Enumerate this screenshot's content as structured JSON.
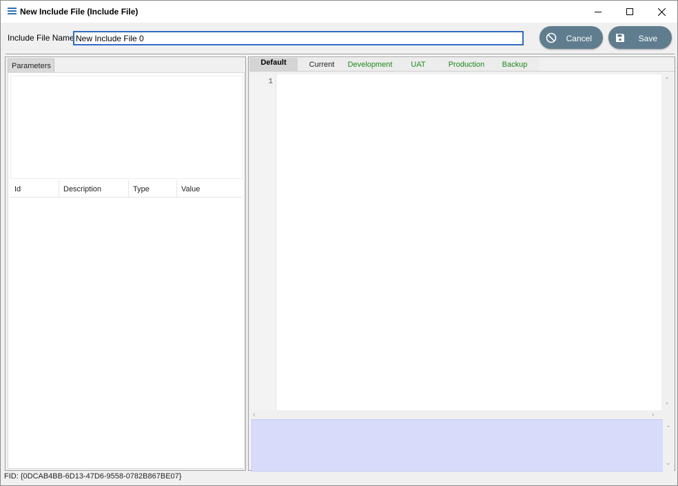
{
  "window": {
    "title": "New Include File (Include File)",
    "icon": "menu-lines-icon"
  },
  "form": {
    "name_label": "Include File Name",
    "name_value": "New Include File 0"
  },
  "buttons": {
    "cancel_label": "Cancel",
    "cancel_icon": "cancel-circle-icon",
    "save_label": "Save",
    "save_icon": "floppy-disk-icon",
    "color": "#5f7d8e"
  },
  "left_panel": {
    "tab_label": "Parameters",
    "grid_columns": [
      "Id",
      "Description",
      "Type",
      "Value"
    ]
  },
  "right_panel": {
    "tabs": [
      {
        "label": "Default",
        "active": true
      },
      {
        "label": "Current",
        "active": false
      },
      {
        "label": "Development",
        "active": false
      },
      {
        "label": "UAT",
        "active": false
      },
      {
        "label": "Production",
        "active": false
      },
      {
        "label": "Backup",
        "active": false
      }
    ],
    "line_numbers": [
      "1"
    ],
    "output_color": "#d8dcfa"
  },
  "status": {
    "fid": "FID: {0DCAB4BB-6D13-47D6-9558-0782B867BE07}"
  },
  "colors": {
    "tab_green": "#1d8a1d",
    "input_border": "#2f69c4"
  }
}
